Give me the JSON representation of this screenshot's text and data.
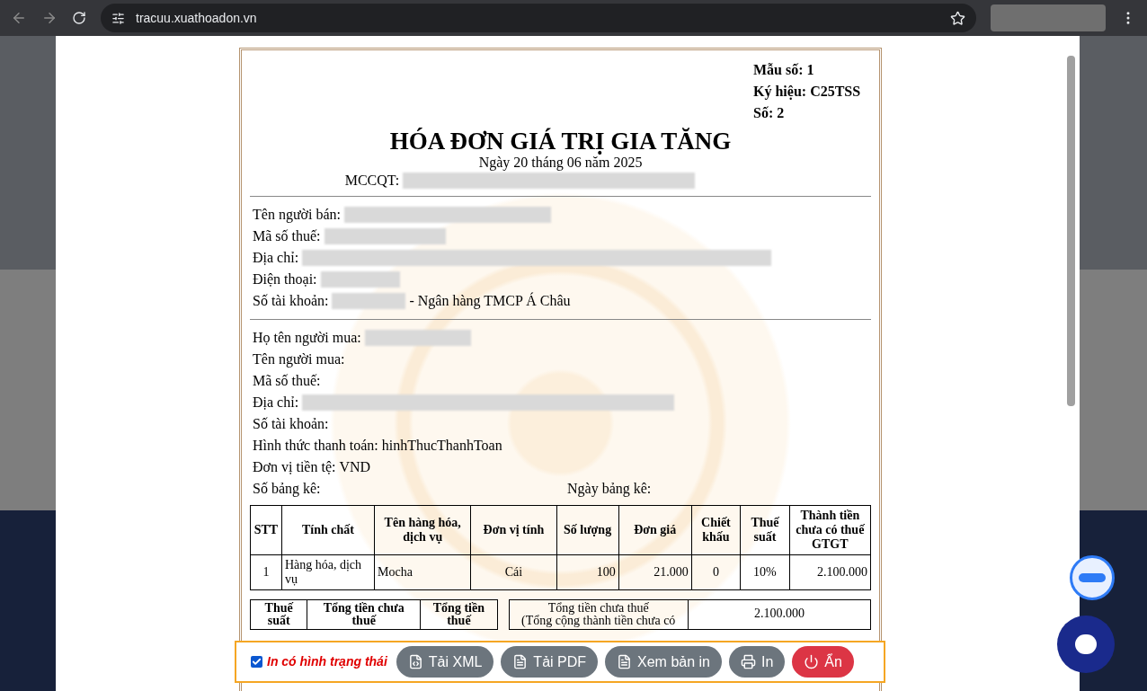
{
  "browser": {
    "url": "tracuu.xuathoadon.vn"
  },
  "invoice": {
    "meta": [
      {
        "label": "Mẫu số:",
        "value": "1"
      },
      {
        "label": "Ký hiệu:",
        "value": "C25TSS"
      },
      {
        "label": "Số:",
        "value": "2"
      }
    ],
    "title": "HÓA ĐƠN GIÁ TRỊ GIA TĂNG",
    "date": "Ngày 20 tháng 06 năm 2025",
    "mccqt": {
      "label": "MCCQT:",
      "redacted": true
    },
    "seller": [
      {
        "label": "Tên người bán:",
        "redacted": true
      },
      {
        "label": "Mã số thuế:",
        "redacted": true
      },
      {
        "label": "Địa chỉ:",
        "redacted": true
      },
      {
        "label": "Điện thoại:",
        "redacted": true
      },
      {
        "label": "Số tài khoản:",
        "redacted": true,
        "value": "- Ngân hàng TMCP Á Châu"
      }
    ],
    "buyer": [
      {
        "label": "Họ tên người mua:",
        "redacted": true
      },
      {
        "label": "Tên người mua:",
        "redacted": false
      },
      {
        "label": "Mã số thuế:",
        "redacted": false
      },
      {
        "label": "Địa chỉ:",
        "redacted": true
      },
      {
        "label": "Số tài khoản:",
        "redacted": false
      },
      {
        "label": "Hình thức thanh toán:",
        "redacted": false,
        "value": "hinhThucThanhToan"
      },
      {
        "label": "Đơn vị tiền tệ:",
        "redacted": false,
        "value": "VND"
      }
    ],
    "list_row": [
      "Số bảng kê:",
      "Ngày bảng kê:"
    ],
    "items": {
      "columns": [
        "STT",
        "Tính chất",
        "Tên hàng hóa, dịch vụ",
        "Đơn vị tính",
        "Số lượng",
        "Đơn giá",
        "Chiết khấu",
        "Thuế suất",
        "Thành tiền chưa có thuế GTGT"
      ],
      "rows": [
        [
          "1",
          "Hàng hóa, dịch vụ",
          "Mocha",
          "Cái",
          "100",
          "21.000",
          "0",
          "10%",
          "2.100.000"
        ]
      ]
    },
    "tax_summary": {
      "columns": [
        "Thuế suất",
        "Tổng tiền chưa thuế",
        "Tổng tiền thuế"
      ]
    },
    "totals": [
      {
        "label": "Tổng tiền chưa thuế",
        "note": "(Tổng cộng thành tiền chưa có",
        "value": "2.100.000"
      }
    ]
  },
  "actions": {
    "checkbox": {
      "label": "In có hình trạng thái",
      "checked": true
    },
    "buttons": [
      {
        "label": "Tải XML",
        "kind": "xml"
      },
      {
        "label": "Tải PDF",
        "kind": "pdf"
      },
      {
        "label": "Xem bản in",
        "kind": "pdf"
      },
      {
        "label": "In",
        "kind": "print"
      },
      {
        "label": "Ẩn",
        "kind": "power"
      }
    ]
  }
}
